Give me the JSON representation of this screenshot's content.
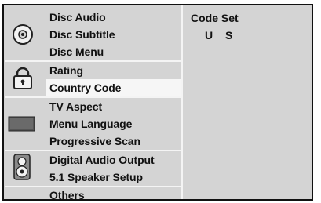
{
  "menu": {
    "groups": [
      {
        "icon": "disc-icon",
        "items": [
          "Disc Audio",
          "Disc Subtitle",
          "Disc Menu"
        ]
      },
      {
        "icon": "lock-icon",
        "items": [
          "Rating",
          "Country Code"
        ]
      },
      {
        "icon": "screen-icon",
        "items": [
          "TV Aspect",
          "Menu Language",
          "Progressive Scan"
        ]
      },
      {
        "icon": "speaker-icon",
        "items": [
          "Digital Audio Output",
          "5.1 Speaker Setup"
        ]
      },
      {
        "icon": "",
        "items": [
          "Others"
        ]
      }
    ],
    "selected": "Country Code"
  },
  "content": {
    "title": "Code Set",
    "value": "U S"
  },
  "colors": {
    "panel_bg": "#d4d4d4",
    "selected_bg": "#f6f6f6",
    "separator": "#f4f4f4",
    "border": "#111111"
  }
}
